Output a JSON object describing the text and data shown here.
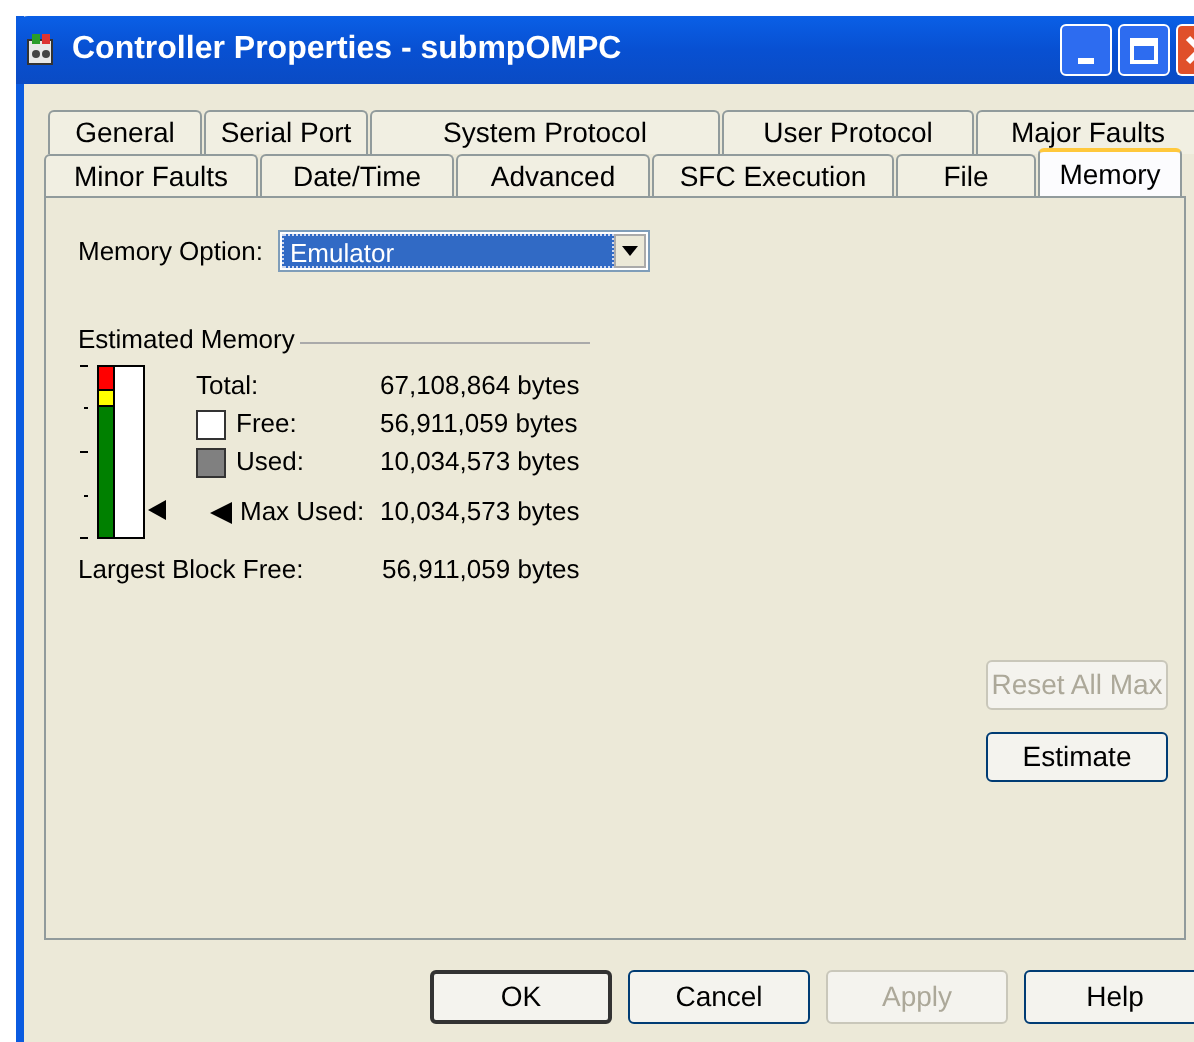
{
  "window": {
    "title": "Controller Properties - submpOMPC"
  },
  "tab_rows": [
    [
      {
        "label": "General",
        "selected": false
      },
      {
        "label": "Serial Port",
        "selected": false
      },
      {
        "label": "System Protocol",
        "selected": false
      },
      {
        "label": "User Protocol",
        "selected": false
      },
      {
        "label": "Major Faults",
        "selected": false
      }
    ],
    [
      {
        "label": "Minor Faults",
        "selected": false
      },
      {
        "label": "Date/Time",
        "selected": false
      },
      {
        "label": "Advanced",
        "selected": false
      },
      {
        "label": "SFC Execution",
        "selected": false
      },
      {
        "label": "File",
        "selected": false
      },
      {
        "label": "Memory",
        "selected": true
      }
    ]
  ],
  "memory_option": {
    "label": "Memory Option:",
    "value": "Emulator"
  },
  "estimated_memory": {
    "title": "Estimated Memory",
    "rows": [
      {
        "kind": "plain",
        "label": "Total:",
        "value": "67,108,864 bytes"
      },
      {
        "kind": "free",
        "label": "Free:",
        "value": "56,911,059 bytes"
      },
      {
        "kind": "used",
        "label": "Used:",
        "value": "10,034,573 bytes"
      },
      {
        "kind": "max",
        "label": "Max Used:",
        "value": "10,034,573 bytes"
      }
    ],
    "largest_block": {
      "label": "Largest Block Free:",
      "value": "56,911,059 bytes"
    }
  },
  "side_buttons": [
    {
      "label": "Reset All Max",
      "disabled": true
    },
    {
      "label": "Estimate",
      "disabled": false
    }
  ],
  "buttons": [
    {
      "label": "OK",
      "disabled": false,
      "default": true
    },
    {
      "label": "Cancel",
      "disabled": false,
      "default": false
    },
    {
      "label": "Apply",
      "disabled": true,
      "default": false
    },
    {
      "label": "Help",
      "disabled": false,
      "default": false
    }
  ]
}
